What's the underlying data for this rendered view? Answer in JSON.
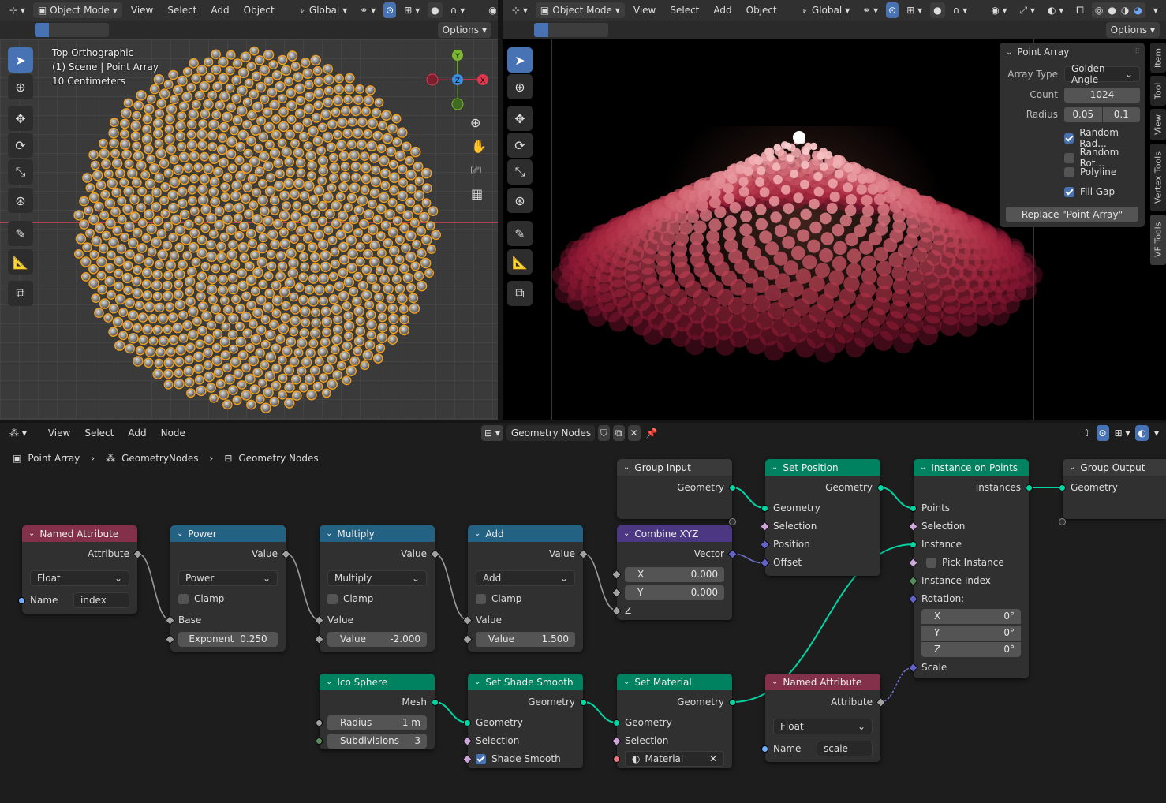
{
  "left_header": {
    "mode": "Object Mode",
    "menus": [
      "View",
      "Select",
      "Add",
      "Object"
    ],
    "orientation": "Global",
    "options": "Options"
  },
  "left_vp": {
    "view_name": "Top Orthographic",
    "scene_info": "(1) Scene | Point Array",
    "scale": "10 Centimeters",
    "gizmo": {
      "y": "Y",
      "z": "Z",
      "x": "X"
    }
  },
  "right_header": {
    "mode": "Object Mode",
    "menus": [
      "View",
      "Select",
      "Add",
      "Object"
    ],
    "orientation": "Global",
    "options": "Options"
  },
  "panel": {
    "title": "Point Array",
    "array_type_label": "Array Type",
    "array_type": "Golden Angle",
    "count_label": "Count",
    "count": "1024",
    "radius_label": "Radius",
    "radius_min": "0.05",
    "radius_max": "0.1",
    "random_rad": "Random Rad...",
    "random_rad_on": true,
    "random_rot": "Random Rot...",
    "random_rot_on": false,
    "polyline": "Polyline",
    "polyline_on": false,
    "fill_gap": "Fill Gap",
    "fill_gap_on": true,
    "replace_btn": "Replace \"Point Array\""
  },
  "side_tabs": [
    "Item",
    "Tool",
    "View",
    "Vertex Tools",
    "VF Tools"
  ],
  "node_header": {
    "menus": [
      "View",
      "Select",
      "Add",
      "Node"
    ],
    "tree_name": "Geometry Nodes"
  },
  "breadcrumb": {
    "object": "Point Array",
    "modifier": "GeometryNodes",
    "tree": "Geometry Nodes"
  },
  "colors": {
    "attr": "#83314a",
    "math": "#246283",
    "geom": "#00815f",
    "vec": "#4b3782",
    "input": "#83314a",
    "socket_geo": "#00d6a3",
    "socket_float": "#a1a1a1",
    "socket_vec": "#6363c7",
    "socket_bool": "#cca6d6",
    "socket_int": "#598c5c",
    "socket_mat": "#eb7582",
    "socket_str": "#70b2ff"
  },
  "nodes": {
    "named_attr1": {
      "title": "Named Attribute",
      "out": "Attribute",
      "type": "Float",
      "name_label": "Name",
      "name": "index"
    },
    "power": {
      "title": "Power",
      "out": "Value",
      "op": "Power",
      "clamp": "Clamp",
      "in1": "Base",
      "exp_label": "Exponent",
      "exp": "0.250"
    },
    "multiply": {
      "title": "Multiply",
      "out": "Value",
      "op": "Multiply",
      "clamp": "Clamp",
      "in1": "Value",
      "v_label": "Value",
      "v": "-2.000"
    },
    "add": {
      "title": "Add",
      "out": "Value",
      "op": "Add",
      "clamp": "Clamp",
      "in1": "Value",
      "v_label": "Value",
      "v": "1.500"
    },
    "group_input": {
      "title": "Group Input",
      "out": "Geometry"
    },
    "combine": {
      "title": "Combine XYZ",
      "out": "Vector",
      "x_label": "X",
      "x": "0.000",
      "y_label": "Y",
      "y": "0.000",
      "z": "Z"
    },
    "set_position": {
      "title": "Set Position",
      "out": "Geometry",
      "in_geo": "Geometry",
      "sel": "Selection",
      "pos": "Position",
      "off": "Offset"
    },
    "instance": {
      "title": "Instance on Points",
      "out": "Instances",
      "points": "Points",
      "sel": "Selection",
      "inst": "Instance",
      "pick": "Pick Instance",
      "idx": "Instance Index",
      "rot": "Rotation:",
      "rx_label": "X",
      "rx": "0°",
      "ry_label": "Y",
      "ry": "0°",
      "rz_label": "Z",
      "rz": "0°",
      "scale": "Scale"
    },
    "group_output": {
      "title": "Group Output",
      "in": "Geometry"
    },
    "ico": {
      "title": "Ico Sphere",
      "out": "Mesh",
      "r_label": "Radius",
      "r": "1 m",
      "s_label": "Subdivisions",
      "s": "3"
    },
    "shade": {
      "title": "Set Shade Smooth",
      "out": "Geometry",
      "in_geo": "Geometry",
      "sel": "Selection",
      "smooth": "Shade Smooth"
    },
    "material": {
      "title": "Set Material",
      "out": "Geometry",
      "in_geo": "Geometry",
      "sel": "Selection",
      "mat": "Material"
    },
    "named_attr2": {
      "title": "Named Attribute",
      "out": "Attribute",
      "type": "Float",
      "name_label": "Name",
      "name": "scale"
    }
  }
}
